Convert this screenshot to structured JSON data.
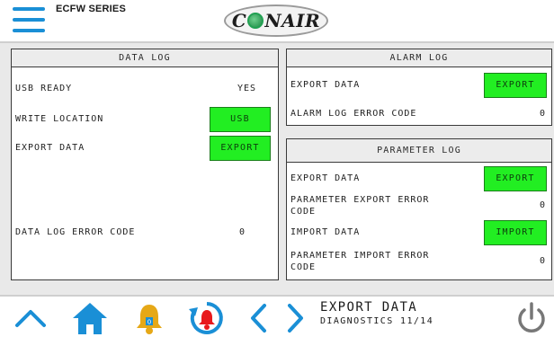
{
  "header": {
    "series": "ECFW SERIES",
    "logo_text_pre": "C",
    "logo_text_post": "NAIR"
  },
  "data_log": {
    "title": "DATA LOG",
    "usb_ready_label": "USB READY",
    "usb_ready_value": "YES",
    "write_location_label": "WRITE LOCATION",
    "write_location_button": "USB",
    "export_label": "EXPORT DATA",
    "export_button": "EXPORT",
    "error_label": "DATA LOG ERROR CODE",
    "error_value": "0"
  },
  "alarm_log": {
    "title": "ALARM LOG",
    "export_label": "EXPORT DATA",
    "export_button": "EXPORT",
    "error_label": "ALARM LOG ERROR CODE",
    "error_value": "0"
  },
  "parameter_log": {
    "title": "PARAMETER LOG",
    "export_label": "EXPORT DATA",
    "export_button": "EXPORT",
    "export_error_label_line1": "PARAMETER EXPORT ERROR",
    "export_error_label_line2": "CODE",
    "export_error_value": "0",
    "import_label": "IMPORT DATA",
    "import_button": "IMPORT",
    "import_error_label_line1": "PARAMETER IMPORT ERROR",
    "import_error_label_line2": "CODE",
    "import_error_value": "0"
  },
  "footer": {
    "title": "EXPORT DATA",
    "subtitle": "DIAGNOSTICS 11/14",
    "icons": [
      "chevron-up-icon",
      "home-icon",
      "alarm-bell-icon",
      "alarm-history-icon",
      "chevron-left-icon",
      "chevron-right-icon",
      "power-icon"
    ]
  },
  "colors": {
    "accent_blue": "#1a8fd6",
    "button_green": "#22ee22",
    "alarm_red": "#e8191c",
    "bell_gold": "#e6a817"
  }
}
